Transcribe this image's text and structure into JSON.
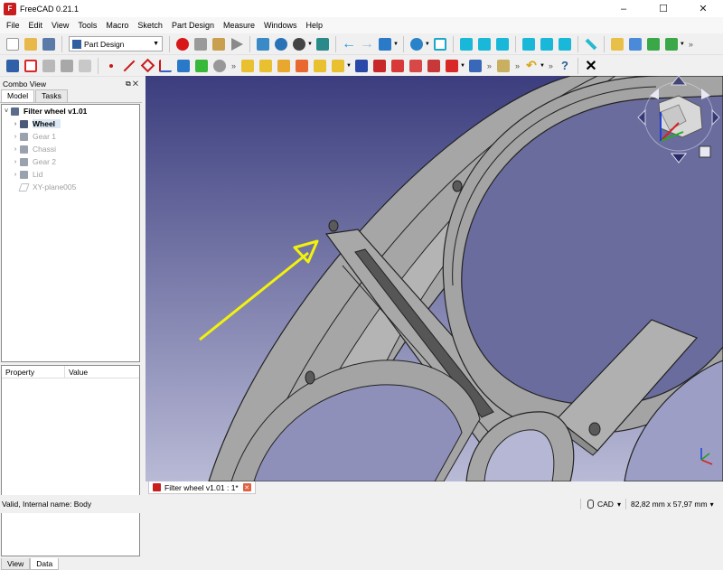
{
  "window": {
    "title": "FreeCAD 0.21.1",
    "app_icon_glyph": "F",
    "controls": [
      "–",
      "☐",
      "✕"
    ]
  },
  "menubar": {
    "items": [
      "File",
      "Edit",
      "View",
      "Tools",
      "Macro",
      "Sketch",
      "Part Design",
      "Measure",
      "Windows",
      "Help"
    ]
  },
  "toolbar": {
    "workbench": "Part Design",
    "overflow_glyph": "»"
  },
  "combo_view": {
    "title": "Combo View",
    "title_controls": "⧉ ✕",
    "tabs": [
      "Model",
      "Tasks"
    ],
    "tree": [
      {
        "label": "Filter wheel v1.01",
        "state": "root",
        "arrow": "˅",
        "icon_color": "#5a6e8c"
      },
      {
        "label": "Wheel",
        "state": "selected",
        "arrow": "›",
        "icon_color": "#4a5a78"
      },
      {
        "label": "Gear 1",
        "state": "hidden",
        "arrow": "›",
        "icon_color": "#9aa2ae"
      },
      {
        "label": "Chassi",
        "state": "hidden",
        "arrow": "›",
        "icon_color": "#9aa2ae"
      },
      {
        "label": "Gear 2",
        "state": "hidden",
        "arrow": "›",
        "icon_color": "#9aa2ae"
      },
      {
        "label": "Lid",
        "state": "hidden",
        "arrow": "›",
        "icon_color": "#9aa2ae"
      },
      {
        "label": "XY-plane005",
        "state": "hidden",
        "arrow": "",
        "icon_color": "#c8ccd2"
      }
    ],
    "property_headers": [
      "Property",
      "Value"
    ],
    "bottom_tabs": [
      "View",
      "Data"
    ]
  },
  "document_tab": {
    "label": "Filter wheel v1.01 : 1*",
    "close_glyph": "✕"
  },
  "status": {
    "message": "Valid, Internal name: Body",
    "navigation_style": "CAD",
    "dimensions": "82,82 mm x 57,97 mm",
    "caret": "▾"
  },
  "colors": {
    "viewport_top": "#3b3d7e",
    "viewport_bottom": "#b9bad6",
    "model_face": "#a6a6a6",
    "annotation_arrow": "#f2f20a",
    "selection": "#dde8f5"
  }
}
